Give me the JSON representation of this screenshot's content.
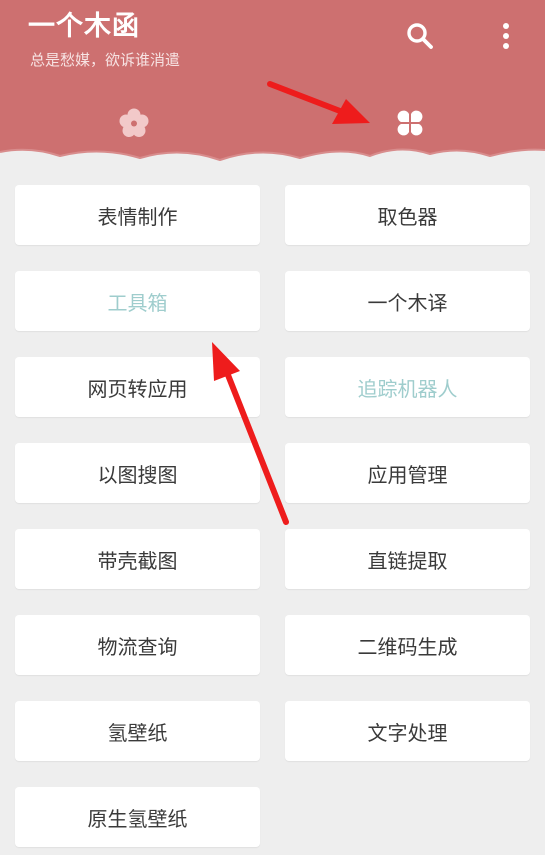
{
  "app": {
    "title": "一个木函",
    "subtitle": "总是愁媒，欲诉谁消遣"
  },
  "colors": {
    "header": "#cd7070",
    "page_bg": "#eeeeee",
    "card_bg": "#ffffff",
    "text": "#3a3a3a",
    "muted_text": "#9fcdcd",
    "annotation_arrow": "#ee1c1c"
  },
  "toolbar": {
    "search_icon": "search-icon",
    "more_icon": "more-vertical-icon"
  },
  "tabs": [
    {
      "icon": "flower-icon",
      "selected": false
    },
    {
      "icon": "clover-icon",
      "selected": true
    }
  ],
  "tools": [
    {
      "label": "表情制作",
      "muted": false
    },
    {
      "label": "取色器",
      "muted": false
    },
    {
      "label": "工具箱",
      "muted": true
    },
    {
      "label": "一个木译",
      "muted": false
    },
    {
      "label": "网页转应用",
      "muted": false
    },
    {
      "label": "追踪机器人",
      "muted": true
    },
    {
      "label": "以图搜图",
      "muted": false
    },
    {
      "label": "应用管理",
      "muted": false
    },
    {
      "label": "带壳截图",
      "muted": false
    },
    {
      "label": "直链提取",
      "muted": false
    },
    {
      "label": "物流查询",
      "muted": false
    },
    {
      "label": "二维码生成",
      "muted": false
    },
    {
      "label": "氢壁纸",
      "muted": false
    },
    {
      "label": "文字处理",
      "muted": false
    },
    {
      "label": "原生氢壁纸",
      "muted": false
    }
  ]
}
